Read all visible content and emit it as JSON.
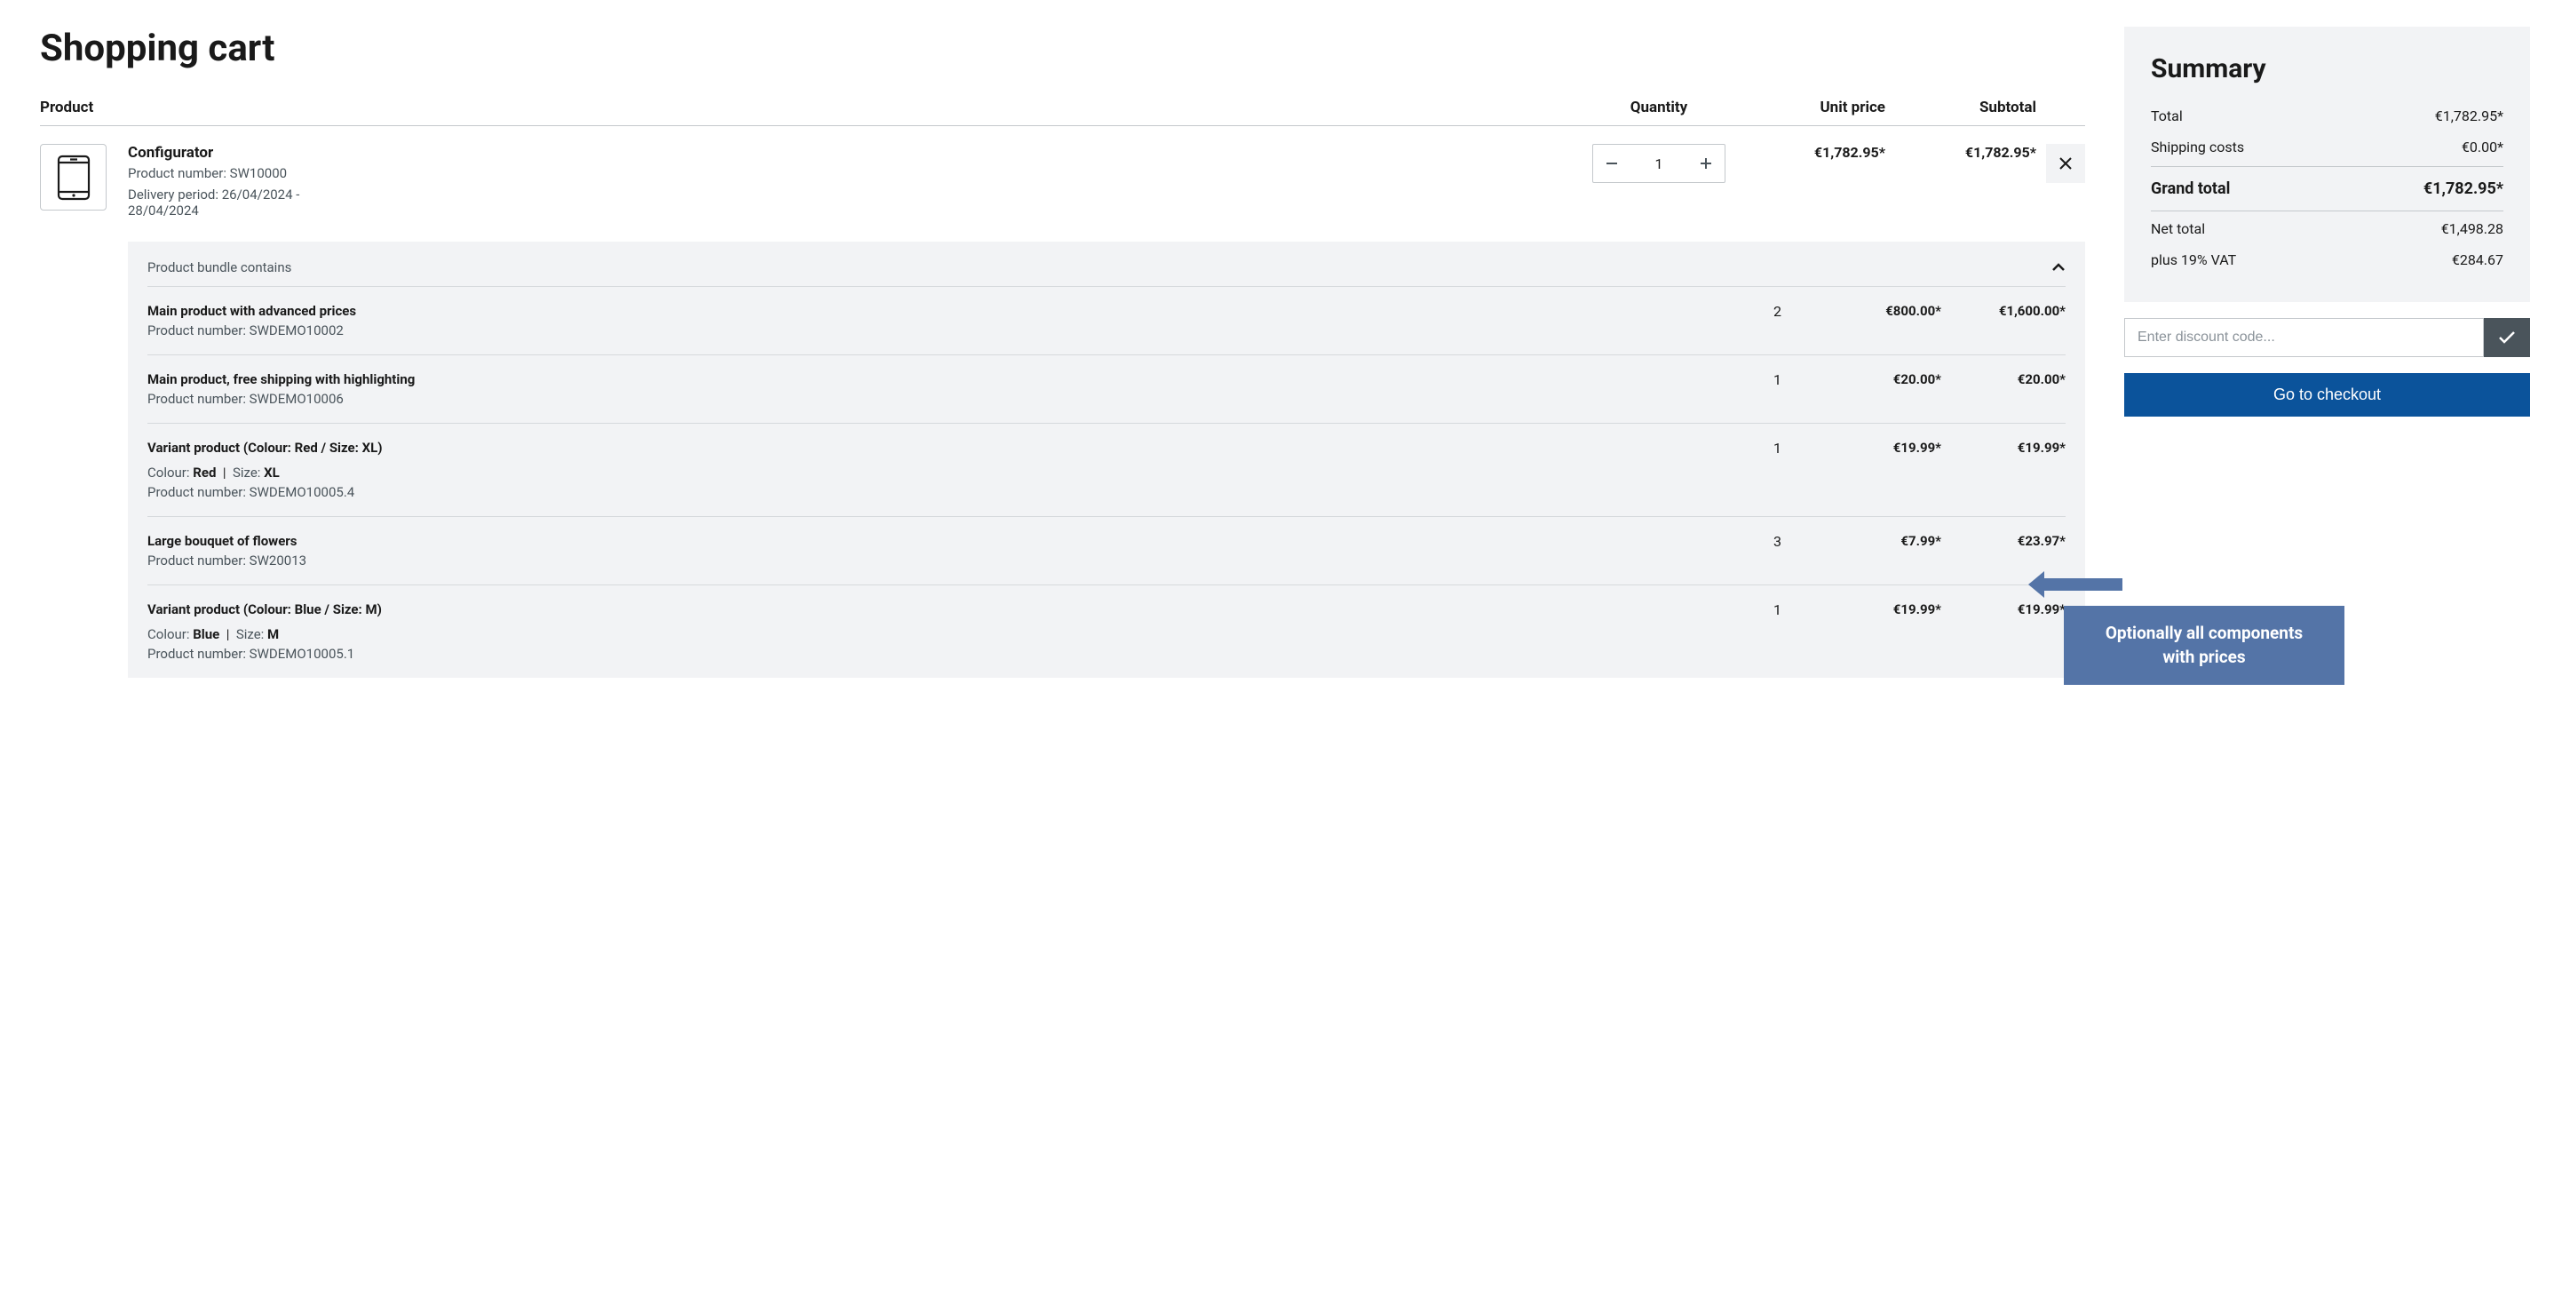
{
  "page_title": "Shopping cart",
  "headers": {
    "product": "Product",
    "quantity": "Quantity",
    "unit_price": "Unit price",
    "subtotal": "Subtotal"
  },
  "product": {
    "name": "Configurator",
    "pn_label": "Product number: SW10000",
    "delivery": "Delivery period: 26/04/2024 - 28/04/2024",
    "qty": "1",
    "unit_price": "€1,782.95*",
    "subtotal": "€1,782.95*"
  },
  "bundle": {
    "label": "Product bundle contains",
    "items": [
      {
        "title": "Main product with advanced prices",
        "pn": "Product number: SWDEMO10002",
        "attrs": [],
        "qty": "2",
        "unit": "€800.00*",
        "sub": "€1,600.00*"
      },
      {
        "title": "Main product, free shipping with highlighting",
        "pn": "Product number: SWDEMO10006",
        "attrs": [],
        "qty": "1",
        "unit": "€20.00*",
        "sub": "€20.00*"
      },
      {
        "title": "Variant product (Colour: Red / Size: XL)",
        "pn": "Product number: SWDEMO10005.4",
        "attrs": [
          {
            "l": "Colour:",
            "v": "Red"
          },
          {
            "l": "Size:",
            "v": "XL"
          }
        ],
        "qty": "1",
        "unit": "€19.99*",
        "sub": "€19.99*"
      },
      {
        "title": "Large bouquet of flowers",
        "pn": "Product number: SW20013",
        "attrs": [],
        "qty": "3",
        "unit": "€7.99*",
        "sub": "€23.97*"
      },
      {
        "title": "Variant product (Colour: Blue / Size: M)",
        "pn": "Product number: SWDEMO10005.1",
        "attrs": [
          {
            "l": "Colour:",
            "v": "Blue"
          },
          {
            "l": "Size:",
            "v": "M"
          }
        ],
        "qty": "1",
        "unit": "€19.99*",
        "sub": "€19.99*"
      }
    ]
  },
  "summary": {
    "title": "Summary",
    "rows": {
      "total_l": "Total",
      "total_v": "€1,782.95*",
      "ship_l": "Shipping costs",
      "ship_v": "€0.00*",
      "grand_l": "Grand total",
      "grand_v": "€1,782.95*",
      "net_l": "Net total",
      "net_v": "€1,498.28",
      "vat_l": "plus 19% VAT",
      "vat_v": "€284.67"
    },
    "discount_placeholder": "Enter discount code...",
    "checkout": "Go to checkout"
  },
  "callout": "Optionally all components with prices"
}
